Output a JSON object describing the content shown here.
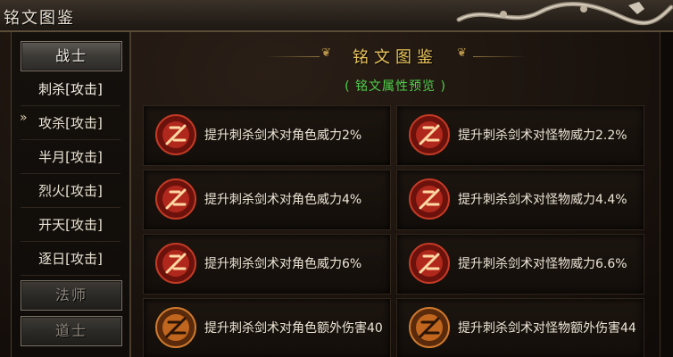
{
  "window": {
    "title": "铭文图鉴"
  },
  "sidebar": {
    "categories": [
      {
        "label": "战士",
        "state": "expanded"
      },
      {
        "label": "法师",
        "state": "collapsed"
      },
      {
        "label": "道士",
        "state": "collapsed"
      }
    ],
    "skills": [
      {
        "label": "刺杀[攻击]",
        "active": true
      },
      {
        "label": "攻杀[攻击]"
      },
      {
        "label": "半月[攻击]"
      },
      {
        "label": "烈火[攻击]"
      },
      {
        "label": "开天[攻击]"
      },
      {
        "label": "逐日[攻击]"
      }
    ],
    "active_marker": "»"
  },
  "main": {
    "title": "铭文图鉴",
    "subtitle": "( 铭文属性预览 )",
    "cards": [
      {
        "text": "提升刺杀剑术对角色威力2%",
        "icon": "red-rune-icon"
      },
      {
        "text": "提升刺杀剑术对怪物威力2.2%",
        "icon": "red-rune-icon"
      },
      {
        "text": "提升刺杀剑术对角色威力4%",
        "icon": "red-rune-icon"
      },
      {
        "text": "提升刺杀剑术对怪物威力4.4%",
        "icon": "red-rune-icon"
      },
      {
        "text": "提升刺杀剑术对角色威力6%",
        "icon": "red-rune-icon"
      },
      {
        "text": "提升刺杀剑术对怪物威力6.6%",
        "icon": "red-rune-icon"
      },
      {
        "text": "提升刺杀剑术对角色额外伤害40",
        "icon": "orange-rune-icon"
      },
      {
        "text": "提升刺杀剑术对怪物额外伤害44",
        "icon": "orange-rune-icon"
      }
    ]
  },
  "colors": {
    "title_gold": "#e8c35a",
    "subtitle_green": "#4fcf4a",
    "rune_red": "#b0281c",
    "rune_orange": "#c0661e"
  }
}
